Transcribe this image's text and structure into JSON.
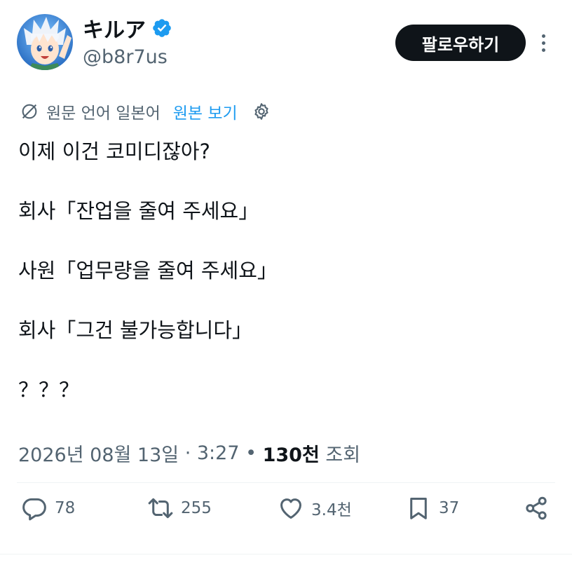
{
  "author": {
    "display_name": "キルア",
    "handle": "@b8r7us",
    "verified": true,
    "avatar_icon": "anime-character-avatar"
  },
  "follow_button_label": "팔로우하기",
  "translation": {
    "source_language_text": "원문 언어 일본어",
    "view_original_label": "원본 보기"
  },
  "tweet": {
    "lines": [
      "이제 이건 코미디잖아?",
      "회사「잔업을 줄여 주세요」",
      "사원「업무량을 줄여 주세요」",
      "회사「그건 불가능합니다」",
      "？？？"
    ]
  },
  "meta": {
    "date": "2026년 08월 13일",
    "separator": " · ",
    "time": "3:27",
    "bullet": " • ",
    "views_count": "130천",
    "views_label": " 조회"
  },
  "actions": {
    "replies": "78",
    "reposts": "255",
    "likes": "3.4천",
    "bookmarks": "37"
  },
  "colors": {
    "text_primary": "#0f1419",
    "text_secondary": "#536471",
    "link_blue": "#1d9bf0",
    "verified_blue": "#1d9bf0",
    "follow_button_bg": "#0f1419"
  }
}
